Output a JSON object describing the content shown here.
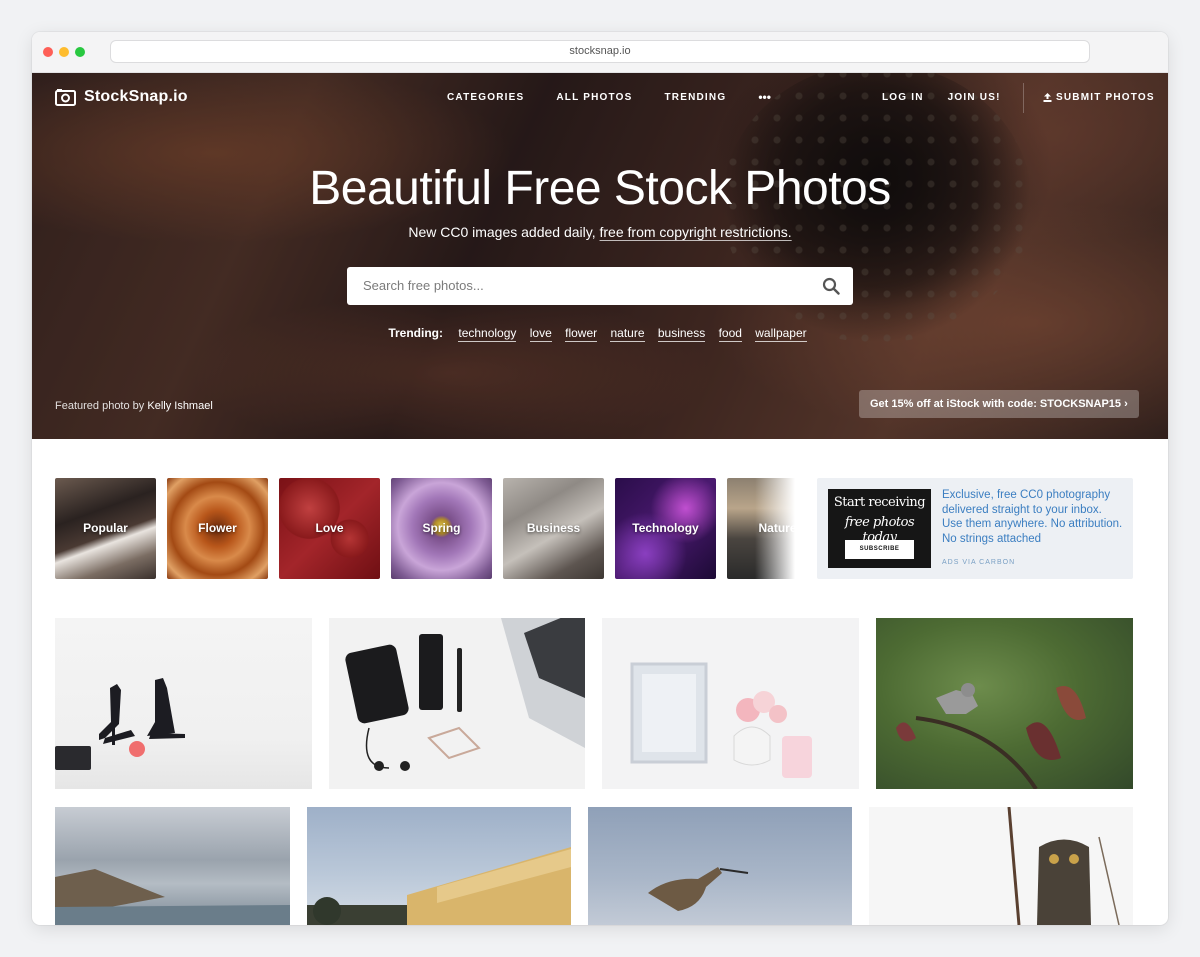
{
  "browser": {
    "url": "stocksnap.io"
  },
  "header": {
    "brand": "StockSnap.io",
    "nav": [
      "CATEGORIES",
      "ALL PHOTOS",
      "TRENDING"
    ],
    "more_glyph": "•••",
    "login": "LOG IN",
    "join": "JOIN US!",
    "submit": "SUBMIT PHOTOS"
  },
  "hero": {
    "title": "Beautiful Free Stock Photos",
    "subtitle_prefix": "New CC0 images added daily,",
    "subtitle_link": "free from copyright restrictions.",
    "search_placeholder": "Search free photos...",
    "trending_label": "Trending:",
    "trending_tags": [
      "technology",
      "love",
      "flower",
      "nature",
      "business",
      "food",
      "wallpaper"
    ],
    "credit_prefix": "Featured photo by",
    "credit_name": "Kelly Ishmael",
    "promo": "Get 15% off at iStock with code: STOCKSNAP15 ›"
  },
  "categories": [
    "Popular",
    "Flower",
    "Love",
    "Spring",
    "Business",
    "Technology",
    "Nature"
  ],
  "ad": {
    "image_line1": "Start receiving",
    "image_line2": "free photos today",
    "image_button": "SUBSCRIBE",
    "text": "Exclusive, free CC0 photography delivered straight to your inbox. Use them anywhere. No attribution. No strings attached",
    "via": "ADS VIA CARBON"
  },
  "colors": {
    "ad_link": "#3b7ec1",
    "hero_overlay": "#2c1d1c"
  }
}
